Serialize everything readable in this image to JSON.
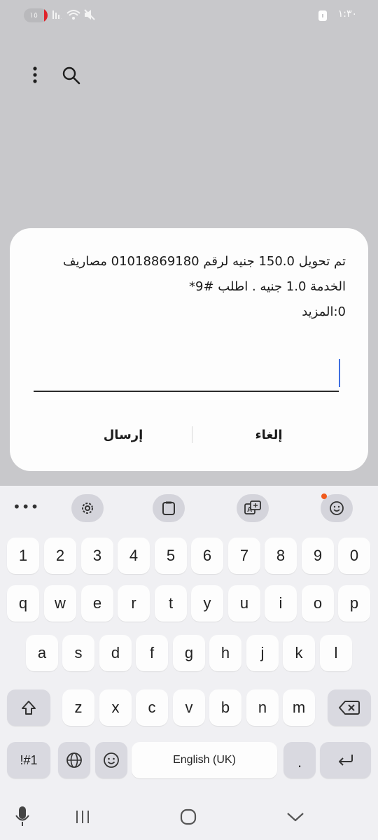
{
  "status_bar": {
    "battery_level": "١٥",
    "battery_fraction": 0.15,
    "time": "١:٣٠"
  },
  "app_bar": {
    "icons": [
      "more-vert-icon",
      "search-icon"
    ]
  },
  "dialog": {
    "message": "تم تحويل 150.0 جنيه لرقم 01018869180 مصاريف\nالخدمة 1.0 جنيه . اطلب #9*\n0:المزيد",
    "input_value": "",
    "cancel_label": "إلغاء",
    "send_label": "إرسال"
  },
  "keyboard": {
    "toolbar": [
      "more-icon",
      "settings-icon",
      "clipboard-icon",
      "translate-icon",
      "emoji-icon"
    ],
    "row_numbers": [
      "1",
      "2",
      "3",
      "4",
      "5",
      "6",
      "7",
      "8",
      "9",
      "0"
    ],
    "row_top": [
      "q",
      "w",
      "e",
      "r",
      "t",
      "y",
      "u",
      "i",
      "o",
      "p"
    ],
    "row_home": [
      "a",
      "s",
      "d",
      "f",
      "g",
      "h",
      "j",
      "k",
      "l"
    ],
    "row_bottom": [
      "z",
      "x",
      "c",
      "v",
      "b",
      "n",
      "m"
    ],
    "symbols_label": "!#1",
    "space_label": "English (UK)",
    "period_label": "."
  },
  "colors": {
    "accent_caret": "#3f6fe0",
    "notification_dot": "#f05a1c",
    "battery_low": "#e0232a"
  }
}
